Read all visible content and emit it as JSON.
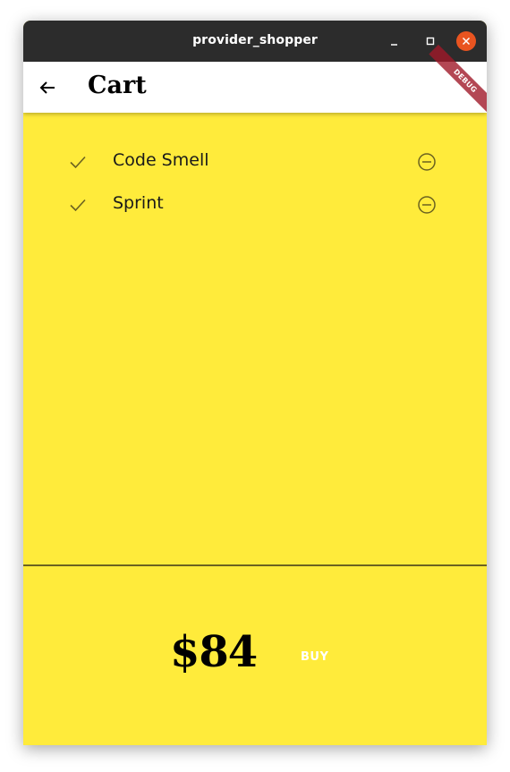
{
  "window": {
    "title": "provider_shopper",
    "controls": [
      "minimize-icon",
      "maximize-icon",
      "close-icon"
    ]
  },
  "appbar": {
    "back_icon": "arrow-left-icon",
    "title": "Cart",
    "debug_banner": "DEBUG"
  },
  "cart": {
    "items": [
      {
        "name": "Code Smell",
        "icon": "check-icon",
        "action_icon": "remove-circle-icon"
      },
      {
        "name": "Sprint",
        "icon": "check-icon",
        "action_icon": "remove-circle-icon"
      }
    ]
  },
  "summary": {
    "total": "$84",
    "buy_label": "BUY"
  },
  "colors": {
    "background": "#ffeb3b",
    "titlebar": "#2c2c2c",
    "close_button": "#e95420",
    "debug_banner": "#a11a2a",
    "icon": "#6b6220"
  }
}
